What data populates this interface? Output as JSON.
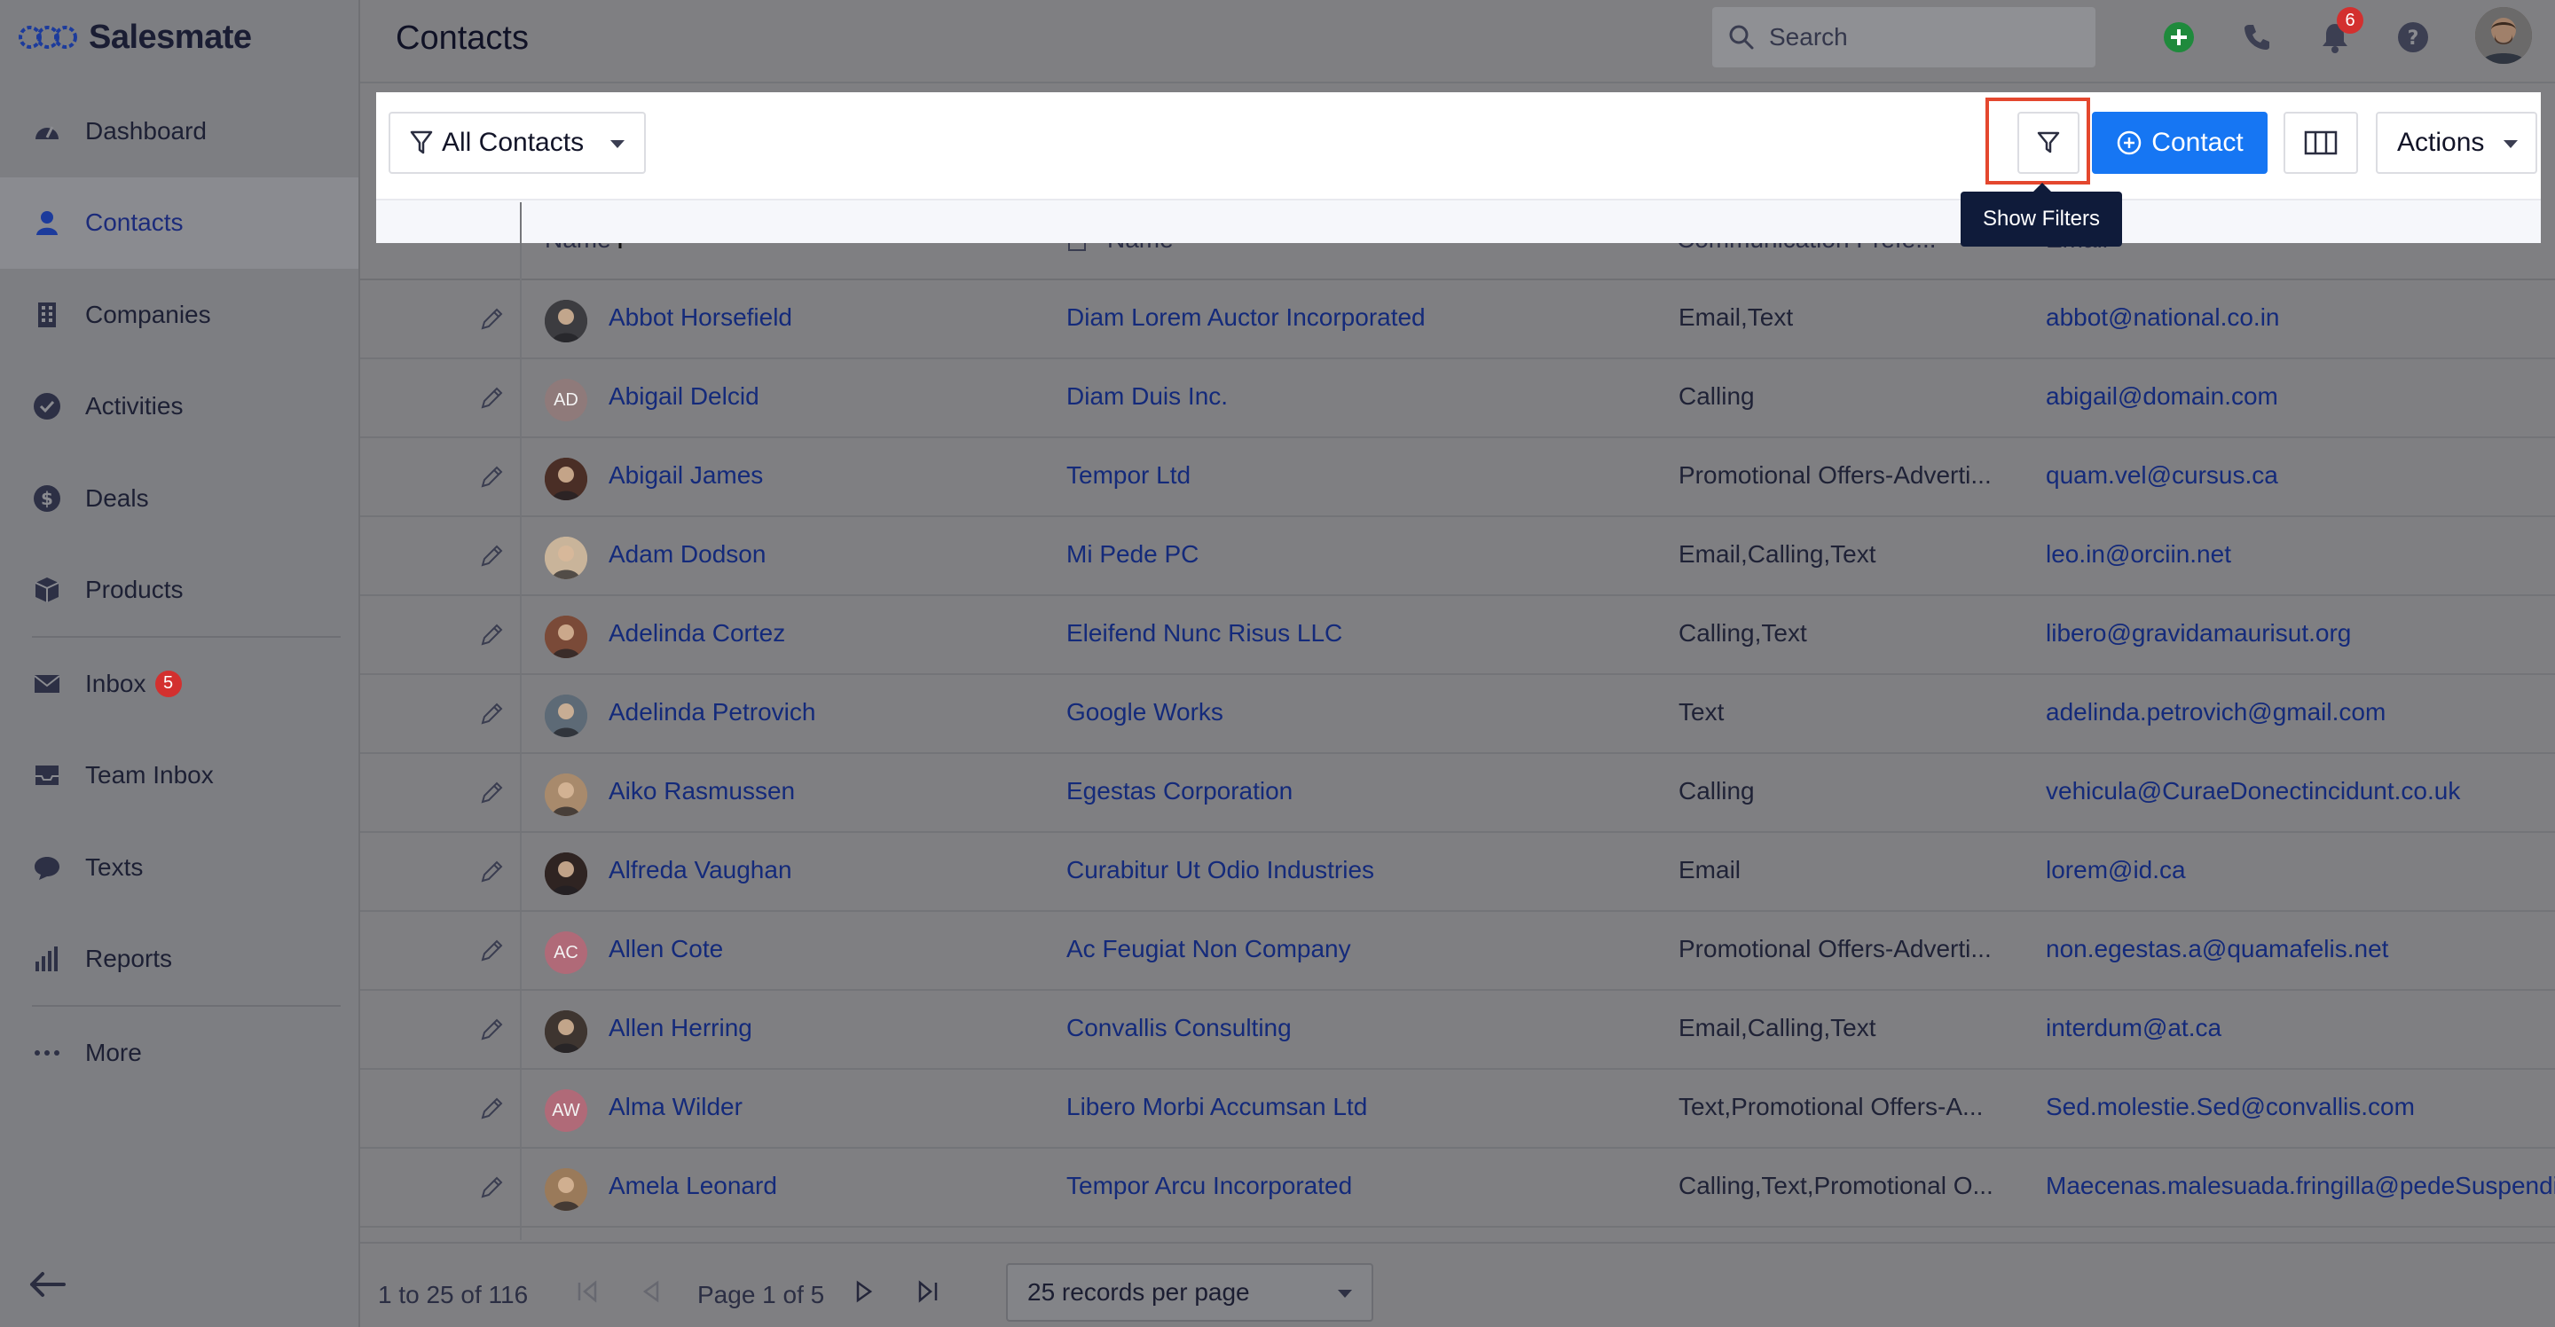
{
  "brand": {
    "name": "Salesmate"
  },
  "sidebar": {
    "items": [
      {
        "label": "Dashboard",
        "icon": "dashboard-icon"
      },
      {
        "label": "Contacts",
        "icon": "person-icon",
        "active": true
      },
      {
        "label": "Companies",
        "icon": "building-icon"
      },
      {
        "label": "Activities",
        "icon": "check-circle-icon"
      },
      {
        "label": "Deals",
        "icon": "dollar-icon"
      },
      {
        "label": "Products",
        "icon": "box-icon"
      },
      {
        "label": "Inbox",
        "icon": "mail-icon",
        "badge": "5"
      },
      {
        "label": "Team Inbox",
        "icon": "tray-icon"
      },
      {
        "label": "Texts",
        "icon": "chat-icon"
      },
      {
        "label": "Reports",
        "icon": "bar-chart-icon"
      },
      {
        "label": "More",
        "icon": "dots-icon"
      }
    ]
  },
  "header": {
    "title": "Contacts",
    "search_placeholder": "Search",
    "notification_count": "6"
  },
  "toolbar": {
    "view_label": "All Contacts",
    "contact_button": "Contact",
    "actions_button": "Actions",
    "tooltip": "Show Filters"
  },
  "table": {
    "headers": {
      "name": "Name",
      "company": "Name",
      "communication": "Communication Prefe...",
      "email": "Email"
    },
    "rows": [
      {
        "name": "Abbot Horsefield",
        "company": "Diam Lorem Auctor Incorporated",
        "comm": "Email,Text",
        "email": "abbot@national.co.in",
        "avatar": "photo",
        "initials": "",
        "color": "#3c3c40"
      },
      {
        "name": "Abigail Delcid",
        "company": "Diam Duis Inc.",
        "comm": "Calling",
        "email": "abigail@domain.com",
        "avatar": "initials",
        "initials": "AD",
        "color": "#8f7a7a"
      },
      {
        "name": "Abigail James",
        "company": "Tempor Ltd",
        "comm": "Promotional Offers-Adverti...",
        "email": "quam.vel@cursus.ca",
        "avatar": "photo",
        "initials": "",
        "color": "#4a2e26"
      },
      {
        "name": "Adam Dodson",
        "company": "Mi Pede PC",
        "comm": "Email,Calling,Text",
        "email": "leo.in@orciin.net",
        "avatar": "photo",
        "initials": "",
        "color": "#c9b49a"
      },
      {
        "name": "Adelinda Cortez",
        "company": "Eleifend Nunc Risus LLC",
        "comm": "Calling,Text",
        "email": "libero@gravidamaurisut.org",
        "avatar": "photo",
        "initials": "",
        "color": "#7a4a38"
      },
      {
        "name": "Adelinda Petrovich",
        "company": "Google Works",
        "comm": "Text",
        "email": "adelinda.petrovich@gmail.com",
        "avatar": "photo",
        "initials": "",
        "color": "#5d6a76"
      },
      {
        "name": "Aiko Rasmussen",
        "company": "Egestas Corporation",
        "comm": "Calling",
        "email": "vehicula@CuraeDonectincidunt.co.uk",
        "avatar": "photo",
        "initials": "",
        "color": "#a88a6c"
      },
      {
        "name": "Alfreda Vaughan",
        "company": "Curabitur Ut Odio Industries",
        "comm": "Email",
        "email": "lorem@id.ca",
        "avatar": "photo",
        "initials": "",
        "color": "#2f2422"
      },
      {
        "name": "Allen Cote",
        "company": "Ac Feugiat Non Company",
        "comm": "Promotional Offers-Adverti...",
        "email": "non.egestas.a@quamafelis.net",
        "avatar": "initials",
        "initials": "AC",
        "color": "#b06a78"
      },
      {
        "name": "Allen Herring",
        "company": "Convallis Consulting",
        "comm": "Email,Calling,Text",
        "email": "interdum@at.ca",
        "avatar": "photo",
        "initials": "",
        "color": "#3e3530"
      },
      {
        "name": "Alma Wilder",
        "company": "Libero Morbi Accumsan Ltd",
        "comm": "Text,Promotional Offers-A...",
        "email": "Sed.molestie.Sed@convallis.com",
        "avatar": "initials",
        "initials": "AW",
        "color": "#b06a78"
      },
      {
        "name": "Amela Leonard",
        "company": "Tempor Arcu Incorporated",
        "comm": "Calling,Text,Promotional O...",
        "email": "Maecenas.malesuada.fringilla@pedeSuspendi",
        "avatar": "photo",
        "initials": "",
        "color": "#9a7a5a"
      }
    ]
  },
  "footer": {
    "range": "1 to 25 of 116",
    "page": "Page 1 of 5",
    "per_page": "25 records per page"
  },
  "colors": {
    "accent": "#1676f3",
    "highlight": "#e4472e",
    "badge": "#d3302f",
    "tooltip_bg": "#0f1b3a"
  }
}
